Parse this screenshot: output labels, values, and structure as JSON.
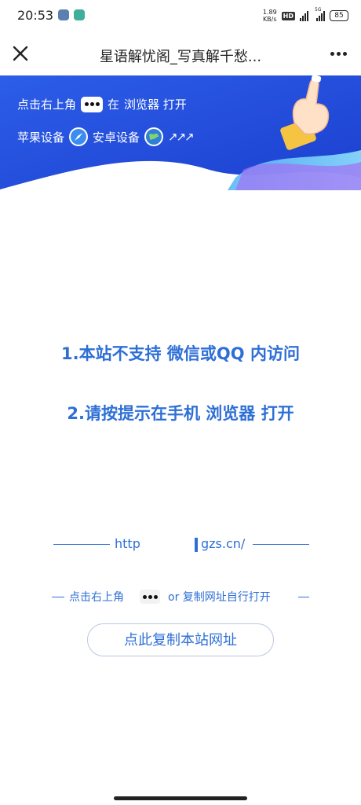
{
  "status_bar": {
    "time": "20:53",
    "net_speed_value": "1.89",
    "net_speed_unit": "KB/s",
    "hd_label": "HD",
    "signal_tag": "5G",
    "battery": "85"
  },
  "nav": {
    "title": "星语解忧阁_写真解千愁..."
  },
  "banner": {
    "line1_prefix": "点击右上角",
    "line1_mid": "在",
    "line1_suffix": "浏览器 打开",
    "apple_label": "苹果设备",
    "android_label": "安卓设备",
    "arrows": "↗↗↗"
  },
  "main": {
    "message1": "1.本站不支持 微信或QQ 内访问",
    "message2": "2.请按提示在手机 浏览器 打开"
  },
  "url": {
    "part1": "http",
    "part2": "gzs.cn/"
  },
  "hint": {
    "prefix": "点击右上角",
    "suffix": "or 复制网址自行打开"
  },
  "copy_button": {
    "label": "点此复制本站网址"
  },
  "colors": {
    "accent": "#2e6fd6",
    "banner_blue": "#2f5fe6"
  }
}
